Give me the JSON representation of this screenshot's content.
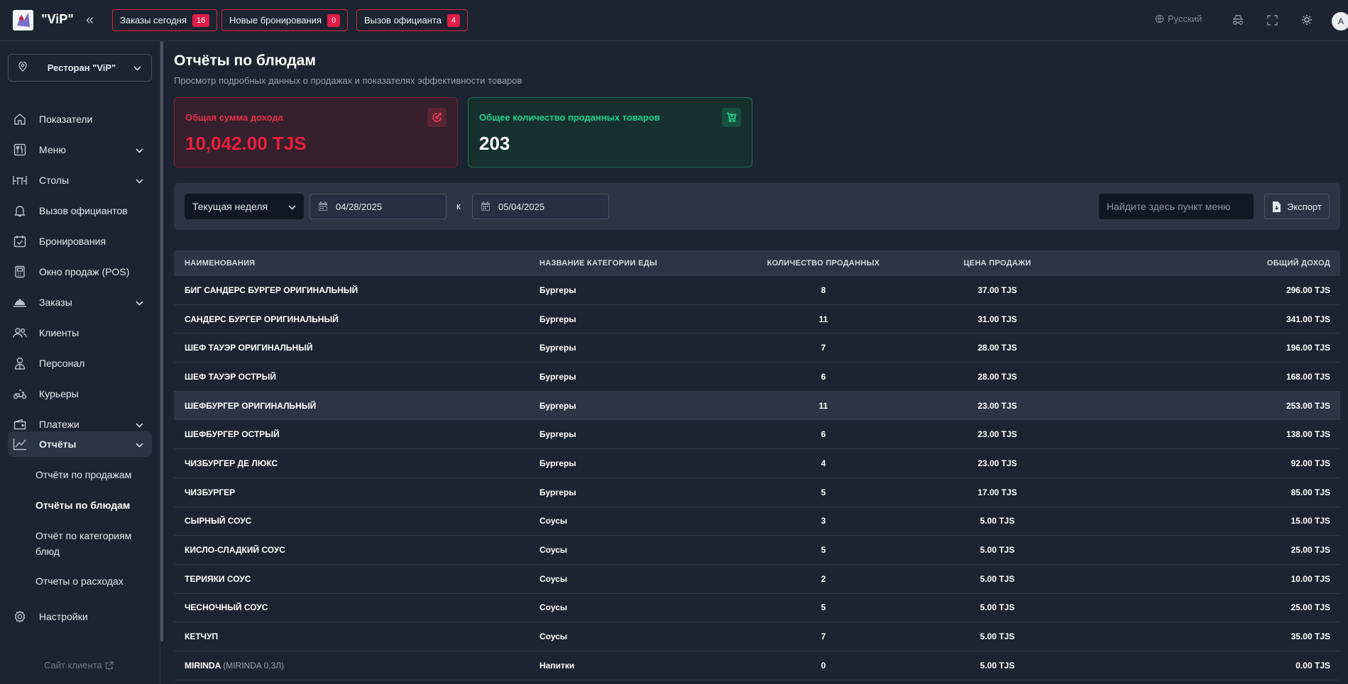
{
  "header": {
    "brand": "\"ViP\"",
    "chips": [
      {
        "label": "Заказы сегодня",
        "count": "16"
      },
      {
        "label": "Новые бронирования",
        "count": "0"
      },
      {
        "label": "Вызов официанта",
        "count": "4"
      }
    ],
    "language": "Русский",
    "avatar_letter": "A"
  },
  "sidebar": {
    "restaurant": "Ресторан \"ViP\"",
    "items": [
      {
        "label": "Показатели"
      },
      {
        "label": "Меню"
      },
      {
        "label": "Столы"
      },
      {
        "label": "Вызов официантов"
      },
      {
        "label": "Бронирования"
      },
      {
        "label": "Окно продаж (POS)"
      },
      {
        "label": "Заказы"
      },
      {
        "label": "Клиенты"
      },
      {
        "label": "Персонал"
      },
      {
        "label": "Курьеры"
      },
      {
        "label": "Платежи"
      },
      {
        "label": "Отчёты"
      }
    ],
    "reports_sub": [
      {
        "label": "Отчёти по продажам"
      },
      {
        "label": "Отчёты по блюдам"
      },
      {
        "label": "Отчёт по категориям блюд"
      },
      {
        "label": "Отчеты о расходах"
      }
    ],
    "settings": "Настройки",
    "client_site": "Сайт клиента"
  },
  "main": {
    "title": "Отчёты по блюдам",
    "subtitle": "Просмотр подробных данных о продажах и показателях эффективности товаров",
    "cards": {
      "revenue_title": "Общая сумма дохода",
      "revenue_value": "10,042.00 TJS",
      "count_title": "Общее количество проданных товаров",
      "count_value": "203"
    },
    "filters": {
      "period": "Текущая неделя",
      "date_from": "04/28/2025",
      "to_label": "к",
      "date_to": "05/04/2025",
      "search_placeholder": "Найдите здесь пункт меню",
      "export_label": "Экспорт"
    },
    "table": {
      "headers": [
        "НАИМЕНОВАНИЯ",
        "НАЗВАНИЕ КАТЕГОРИИ ЕДЫ",
        "КОЛИЧЕСТВО ПРОДАННЫХ",
        "ЦЕНА ПРОДАЖИ",
        "ОБЩИЙ ДОХОД"
      ],
      "rows": [
        {
          "name": "БИГ САНДЕРС БУРГЕР ОРИГИНАЛЬНЫЙ",
          "variant": "",
          "category": "Бургеры",
          "qty": "8",
          "price": "37.00 TJS",
          "total": "296.00 TJS"
        },
        {
          "name": "САНДЕРС БУРГЕР ОРИГИНАЛЬНЫЙ",
          "variant": "",
          "category": "Бургеры",
          "qty": "11",
          "price": "31.00 TJS",
          "total": "341.00 TJS"
        },
        {
          "name": "ШЕФ ТАУЭР ОРИГИНАЛЬНЫЙ",
          "variant": "",
          "category": "Бургеры",
          "qty": "7",
          "price": "28.00 TJS",
          "total": "196.00 TJS"
        },
        {
          "name": "ШЕФ ТАУЭР ОСТРЫЙ",
          "variant": "",
          "category": "Бургеры",
          "qty": "6",
          "price": "28.00 TJS",
          "total": "168.00 TJS"
        },
        {
          "name": "ШЕФБУРГЕР ОРИГИНАЛЬНЫЙ",
          "variant": "",
          "category": "Бургеры",
          "qty": "11",
          "price": "23.00 TJS",
          "total": "253.00 TJS"
        },
        {
          "name": "ШЕФБУРГЕР ОСТРЫЙ",
          "variant": "",
          "category": "Бургеры",
          "qty": "6",
          "price": "23.00 TJS",
          "total": "138.00 TJS"
        },
        {
          "name": "ЧИЗБУРГЕР ДЕ ЛЮКС",
          "variant": "",
          "category": "Бургеры",
          "qty": "4",
          "price": "23.00 TJS",
          "total": "92.00 TJS"
        },
        {
          "name": "ЧИЗБУРГЕР",
          "variant": "",
          "category": "Бургеры",
          "qty": "5",
          "price": "17.00 TJS",
          "total": "85.00 TJS"
        },
        {
          "name": "СЫРНЫЙ СОУС",
          "variant": "",
          "category": "Соусы",
          "qty": "3",
          "price": "5.00 TJS",
          "total": "15.00 TJS"
        },
        {
          "name": "КИСЛО-СЛАДКИЙ СОУС",
          "variant": "",
          "category": "Соусы",
          "qty": "5",
          "price": "5.00 TJS",
          "total": "25.00 TJS"
        },
        {
          "name": "ТЕРИЯКИ СОУС",
          "variant": "",
          "category": "Соусы",
          "qty": "2",
          "price": "5.00 TJS",
          "total": "10.00 TJS"
        },
        {
          "name": "ЧЕСНОЧНЫЙ СОУС",
          "variant": "",
          "category": "Соусы",
          "qty": "5",
          "price": "5.00 TJS",
          "total": "25.00 TJS"
        },
        {
          "name": "КЕТЧУП",
          "variant": "",
          "category": "Соусы",
          "qty": "7",
          "price": "5.00 TJS",
          "total": "35.00 TJS"
        },
        {
          "name": "MIRINDA",
          "variant": "(MIRINDA 0,3Л)",
          "category": "Напитки",
          "qty": "0",
          "price": "5.00 TJS",
          "total": "0.00 TJS"
        }
      ]
    }
  }
}
